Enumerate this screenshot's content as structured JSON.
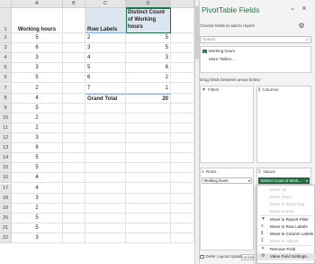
{
  "sheet": {
    "columns": [
      "A",
      "B",
      "C",
      "D"
    ],
    "row_numbers": [
      "1",
      "2",
      "3",
      "4",
      "5",
      "6",
      "7",
      "8",
      "9",
      "10",
      "11",
      "12",
      "13",
      "14",
      "15",
      "16",
      "17",
      "18",
      "19",
      "20",
      "21",
      "22"
    ],
    "col_a_header": "Working hours",
    "col_a_values": [
      "5",
      "6",
      "3",
      "3",
      "5",
      "2",
      "4",
      "5",
      "2",
      "2",
      "3",
      "6",
      "5",
      "5",
      "4",
      "4",
      "3",
      "2",
      "5",
      "5",
      "3"
    ],
    "pivot": {
      "row_labels_header": "Row Labels",
      "value_header": "Distinct Count of Working hours",
      "rows": [
        {
          "label": "2",
          "value": "5"
        },
        {
          "label": "3",
          "value": "5"
        },
        {
          "label": "4",
          "value": "3"
        },
        {
          "label": "5",
          "value": "6"
        },
        {
          "label": "6",
          "value": "2"
        },
        {
          "label": "7",
          "value": "1"
        }
      ],
      "grand_total_label": "Grand Total",
      "grand_total_value": "20"
    }
  },
  "pane": {
    "title": "PivotTable Fields",
    "close_glyph": "×",
    "collapse_glyph": "⌄",
    "choose_label": "Choose fields to add to report:",
    "settings_glyph": "⚙",
    "search_placeholder": "Search",
    "search_glyph": "⌕",
    "fields": [
      {
        "label": "Working hours",
        "checked": true,
        "check_glyph": "✓"
      },
      {
        "label": "More Tables...",
        "checked": false,
        "check_glyph": ""
      }
    ],
    "drag_label": "Drag fields between areas below:",
    "areas": {
      "filters": "Filters",
      "columns": "Columns",
      "rows": "Rows",
      "values": "Values"
    },
    "area_icons": {
      "filters": "▼",
      "columns": "⫼",
      "rows": "≡",
      "values": "Σ"
    },
    "rows_chip": "Working hours",
    "values_chip": "Distinct Count of Work...",
    "dropdown_glyph": "▾",
    "defer_label": "Defer Layout Update",
    "update_label": "Update"
  },
  "context_menu": {
    "items": [
      {
        "label": "Move Up",
        "enabled": false,
        "icon": ""
      },
      {
        "label": "Move Down",
        "enabled": false,
        "icon": ""
      },
      {
        "label": "Move to Beginning",
        "enabled": false,
        "icon": ""
      },
      {
        "label": "Move to End",
        "enabled": false,
        "icon": ""
      },
      {
        "label": "Move to Report Filter",
        "enabled": true,
        "icon": "▼"
      },
      {
        "label": "Move to Row Labels",
        "enabled": true,
        "icon": "≡"
      },
      {
        "label": "Move to Column Labels",
        "enabled": true,
        "icon": "⫼"
      },
      {
        "label": "Move to Values",
        "enabled": false,
        "icon": "Σ"
      },
      {
        "label": "Remove Field",
        "enabled": true,
        "icon": "✕"
      },
      {
        "label": "Value Field Settings...",
        "enabled": true,
        "icon": "⚙"
      }
    ]
  },
  "colors": {
    "accent": "#217346",
    "pivot_header_fill": "#dce6f1",
    "pivot_border": "#8ea9db"
  }
}
